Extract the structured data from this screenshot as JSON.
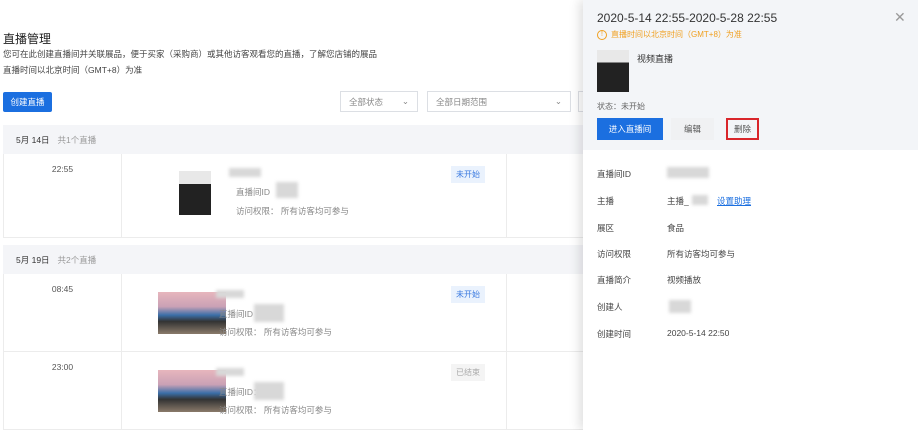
{
  "page": {
    "title": "直播管理",
    "desc1": "您可在此创建直播间并关联展品，便于买家（采购商）或其他访客观看您的直播，了解您店铺的展品",
    "desc2": "直播时间以北京时间（GMT+8）为准",
    "create_button": "创建直播",
    "filters": [
      {
        "value": "全部状态"
      },
      {
        "value": "全部日期范围"
      }
    ]
  },
  "groups": [
    {
      "date": "5月 14日",
      "count": "共1个直播",
      "rows": [
        {
          "time": "22:55",
          "id_label": "直播间ID",
          "access": "访问权限： 所有访客均可参与",
          "status": "未开始",
          "status_type": "blue"
        }
      ]
    },
    {
      "date": "5月 19日",
      "count": "共2个直播",
      "rows": [
        {
          "time": "08:45",
          "id_label": "直播间ID",
          "access": "访问权限： 所有访客均可参与",
          "status": "未开始",
          "status_type": "blue"
        },
        {
          "time": "23:00",
          "id_label": "直播间ID：",
          "access": "访问权限： 所有访客均可参与",
          "status": "已结束",
          "status_type": "gray"
        }
      ]
    }
  ],
  "drawer": {
    "title": "2020-5-14 22:55-2020-5-28 22:55",
    "notice": "直播时间以北京时间（GMT+8）为准",
    "name": "视频直播",
    "status": "状态：未开始",
    "enter_button": "进入直播间",
    "edit_button": "编辑",
    "delete_button": "删除",
    "fields": {
      "room_id": "直播间ID",
      "host": "主播",
      "host_value": "主播_",
      "set_assistant": "设置助理",
      "zone": "展区",
      "zone_value": "食品",
      "access": "访问权限",
      "access_value": "所有访客均可参与",
      "intro": "直播简介",
      "intro_value": "视频播放",
      "creator": "创建人",
      "created": "创建时间",
      "created_value": "2020-5-14 22:50"
    }
  },
  "colors": {
    "primary": "#1b6fe0",
    "warning": "#f0a020",
    "danger": "#d9262b"
  }
}
